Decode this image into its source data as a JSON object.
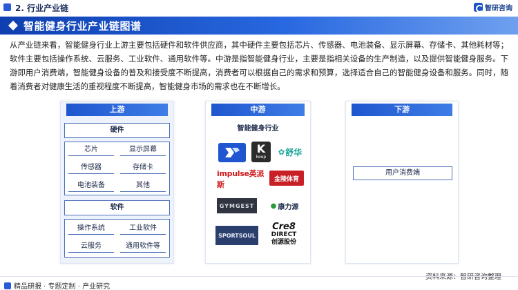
{
  "section": {
    "title": "2. 行业产业链"
  },
  "brand": {
    "name": "智研咨询"
  },
  "banner": {
    "title": "智能健身行业产业链图谱"
  },
  "intro": "从产业链来看，智能健身行业上游主要包括硬件和软件供应商，其中硬件主要包括芯片、传感器、电池装备、显示屏幕、存储卡、其他耗材等；软件主要包括操作系统、云服务、工业软件、通用软件等。中游是指智能健身行业，主要是指相关设备的生产制造，以及提供智能健身服务。下游即用户消费端，智能健身设备的普及和接受度不断提高，消费者可以根据自己的需求和预算，选择适合自己的智能健身设备和服务。同时，随着消费者对健康生活的重视程度不断提高，智能健身市场的需求也在不断增长。",
  "upstream": {
    "header": "上游",
    "hardware": {
      "title": "硬件",
      "items": [
        "芯片",
        "显示屏幕",
        "传感器",
        "存储卡",
        "电池装备",
        "其他"
      ]
    },
    "software": {
      "title": "软件",
      "items": [
        "操作系统",
        "工业软件",
        "云服务",
        "通用软件等"
      ]
    }
  },
  "midstream": {
    "header": "中游",
    "subtitle": "智能健身行业",
    "logos": [
      {
        "name": "keep-like-logo",
        "text": ""
      },
      {
        "name": "keep-logo",
        "text": "keep"
      },
      {
        "name": "shuhua-logo",
        "text": "舒华"
      },
      {
        "name": "impulse-logo",
        "text": "impulse英派斯"
      },
      {
        "name": "jinling-logo",
        "text": "金陵体育"
      },
      {
        "name": "gymgest-logo",
        "text": "GYMGEST"
      },
      {
        "name": "kanglidi-logo",
        "text": "康力源"
      },
      {
        "name": "sportsoul-logo",
        "text": "SPORTSOUL"
      },
      {
        "name": "create-logo",
        "text": "创源股份"
      }
    ]
  },
  "downstream": {
    "header": "下游",
    "item": "用户消费端"
  },
  "footer": {
    "left": "精品研报 · 专题定制 · 产业研究",
    "source": "资料来源：智研咨询整理"
  },
  "colors": {
    "accent": "#1f56cf",
    "border": "#4a6fb8"
  }
}
